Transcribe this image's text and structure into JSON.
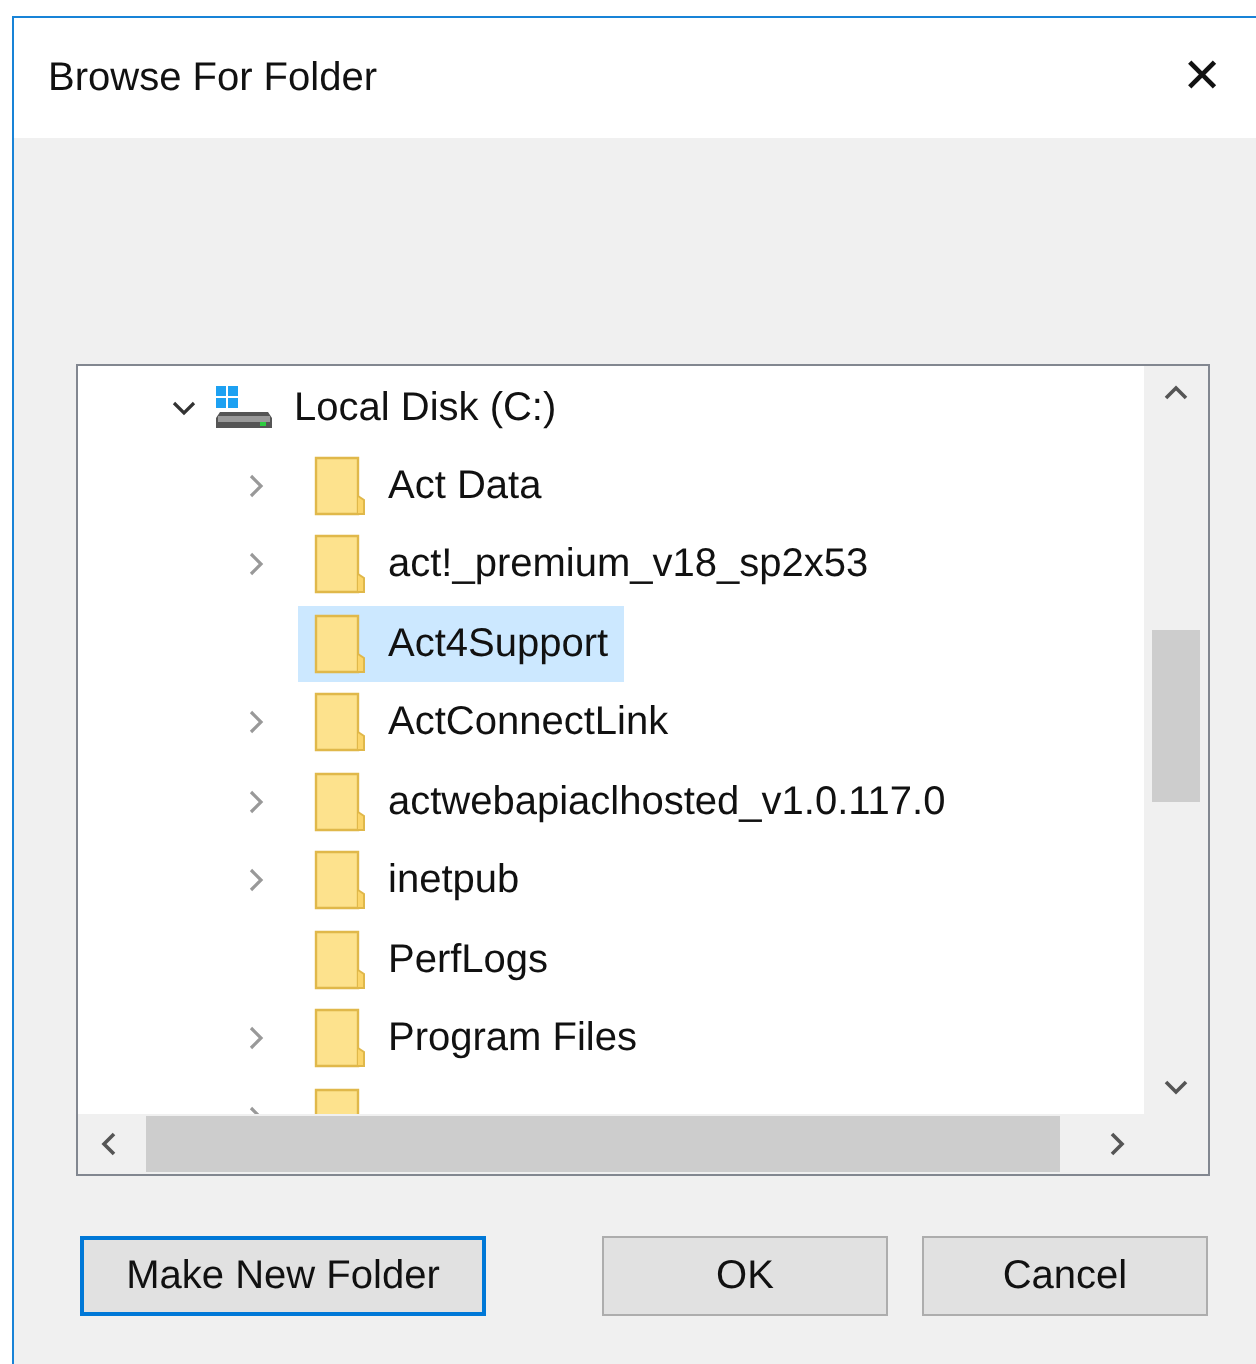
{
  "window": {
    "title": "Browse For Folder",
    "close": "✕"
  },
  "tree": {
    "label": "Local Disk (C:)",
    "expanded": true,
    "children": [
      {
        "label": "Act Data",
        "has_subfolders": true,
        "selected": false
      },
      {
        "label": "act!_premium_v18_sp2x53",
        "has_subfolders": true,
        "selected": false
      },
      {
        "label": "Act4Support",
        "has_subfolders": false,
        "selected": true
      },
      {
        "label": "ActConnectLink",
        "has_subfolders": true,
        "selected": false
      },
      {
        "label": "actwebapiaclhosted_v1.0.117.0",
        "has_subfolders": true,
        "selected": false
      },
      {
        "label": "inetpub",
        "has_subfolders": true,
        "selected": false
      },
      {
        "label": "PerfLogs",
        "has_subfolders": false,
        "selected": false
      },
      {
        "label": "Program Files",
        "has_subfolders": true,
        "selected": false
      },
      {
        "has_subfolders": true,
        "selected": false
      }
    ]
  },
  "buttons": [
    {
      "label": "Make New Folder",
      "focused": true
    },
    {
      "label": "OK",
      "focused": false
    },
    {
      "label": "Cancel",
      "focused": false
    }
  ]
}
